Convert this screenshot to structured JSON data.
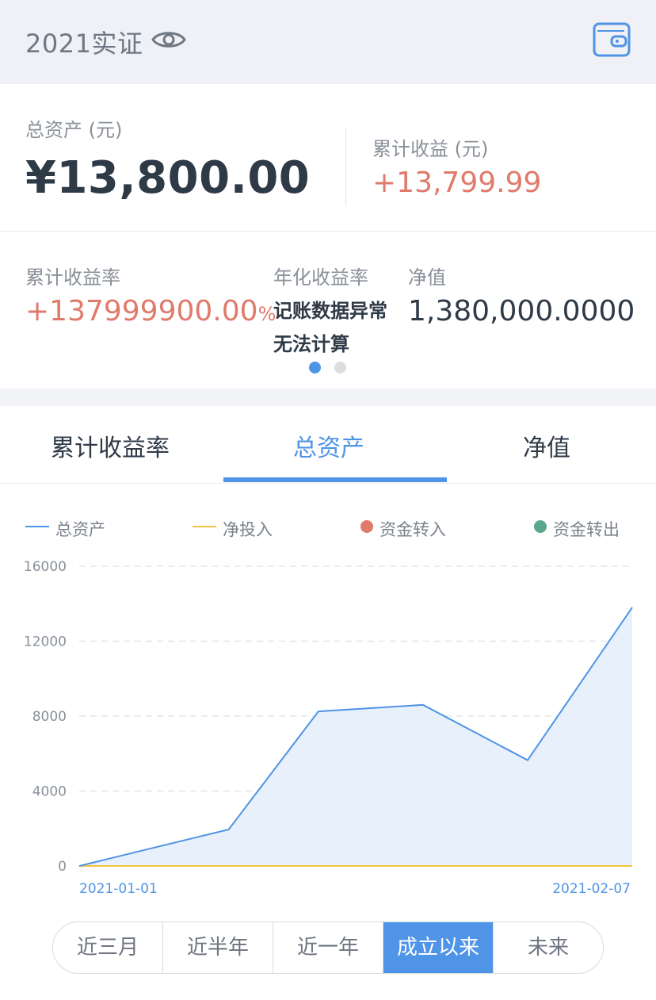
{
  "header": {
    "account_name": "2021实证"
  },
  "summary": {
    "total_assets_label": "总资产 (元)",
    "total_assets_value": "¥13,800.00",
    "cumulative_profit_label": "累计收益 (元)",
    "cumulative_profit_value": "+13,799.99"
  },
  "stats": {
    "cumulative_rate_label": "累计收益率",
    "cumulative_rate_value": "+137999900.00",
    "cumulative_rate_unit": "%",
    "annual_rate_label": "年化收益率",
    "annual_rate_message_line1": "记账数据异常",
    "annual_rate_message_line2": "无法计算",
    "nav_label": "净值",
    "nav_value": "1,380,000.0000",
    "page_indicator": {
      "current": 1,
      "total": 2
    }
  },
  "tabs": [
    {
      "label": "累计收益率",
      "active": false
    },
    {
      "label": "总资产",
      "active": true
    },
    {
      "label": "净值",
      "active": false
    }
  ],
  "legend": [
    {
      "label": "总资产",
      "marker": "line",
      "color": "#4f94e6"
    },
    {
      "label": "净投入",
      "marker": "line",
      "color": "#f0c43c"
    },
    {
      "label": "资金转入",
      "marker": "dot",
      "color": "#e07a6a"
    },
    {
      "label": "资金转出",
      "marker": "dot",
      "color": "#5aa88c"
    }
  ],
  "chart_data": {
    "type": "area",
    "x": [
      "2021-01-01",
      "2021-01-11",
      "2021-01-17",
      "2021-01-24",
      "2021-01-31",
      "2021-02-07"
    ],
    "x_labels": [
      "2021-01-01",
      "2021-02-07"
    ],
    "series": [
      {
        "name": "总资产",
        "values": [
          0,
          1950,
          8250,
          8600,
          5650,
          13800
        ],
        "color": "#4f94e6",
        "fill": "#e8f0fb"
      },
      {
        "name": "净投入",
        "values": [
          0,
          0,
          0,
          0,
          0,
          0
        ],
        "color": "#f0c43c"
      }
    ],
    "y_ticks": [
      0,
      4000,
      8000,
      12000,
      16000
    ],
    "ylim": [
      0,
      16000
    ],
    "grid": true
  },
  "ranges": [
    {
      "label": "近三月",
      "active": false
    },
    {
      "label": "近半年",
      "active": false
    },
    {
      "label": "近一年",
      "active": false
    },
    {
      "label": "成立以来",
      "active": true
    },
    {
      "label": "未来",
      "active": false
    }
  ]
}
